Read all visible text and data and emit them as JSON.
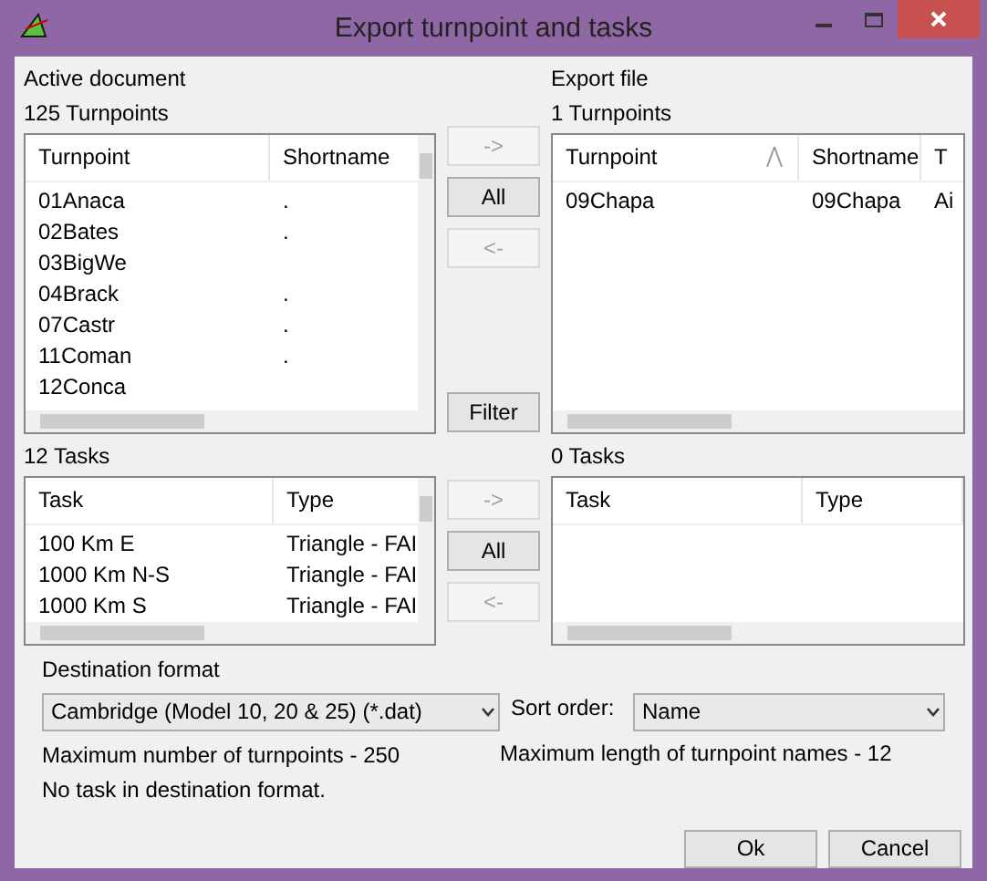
{
  "window": {
    "title": "Export turnpoint and tasks"
  },
  "source": {
    "heading": "Active document",
    "count": "125 Turnpoints",
    "list": {
      "columns": [
        {
          "label": "Turnpoint",
          "sorted": false
        },
        {
          "label": "Shortname",
          "sorted": false
        }
      ],
      "rows": [
        [
          "01Anaca",
          "."
        ],
        [
          "02Bates",
          "."
        ],
        [
          "03BigWe",
          ""
        ],
        [
          "04Brack",
          "."
        ],
        [
          "07Castr",
          "."
        ],
        [
          "11Coman",
          "."
        ],
        [
          "12Conca",
          ""
        ]
      ]
    }
  },
  "target": {
    "heading": "Export file",
    "count": "1 Turnpoints",
    "list": {
      "columns": [
        {
          "label": "Turnpoint",
          "sorted": true
        },
        {
          "label": "Shortname",
          "sorted": false
        },
        {
          "label": "T",
          "sorted": false
        }
      ],
      "rows": [
        [
          "09Chapa",
          "09Chapa",
          "Ai"
        ]
      ]
    }
  },
  "turnpoint_buttons": [
    {
      "label": "->",
      "disabled": true
    },
    {
      "label": "All",
      "disabled": false
    },
    {
      "label": "<-",
      "disabled": true
    },
    {
      "label": "Filter",
      "disabled": false
    }
  ],
  "source_tasks": {
    "count": "12 Tasks",
    "list": {
      "columns": [
        {
          "label": "Task",
          "sorted": false
        },
        {
          "label": "Type",
          "sorted": false
        }
      ],
      "rows": [
        [
          "100 Km E",
          "Triangle - FAI"
        ],
        [
          "1000 Km N-S",
          "Triangle - FAI"
        ],
        [
          "1000 Km S",
          "Triangle - FAI"
        ]
      ]
    }
  },
  "target_tasks": {
    "count": "0 Tasks",
    "list": {
      "columns": [
        {
          "label": "Task",
          "sorted": false
        },
        {
          "label": "Type",
          "sorted": false
        }
      ]
    }
  },
  "task_buttons": [
    {
      "label": "->",
      "disabled": true
    },
    {
      "label": "All",
      "disabled": false
    },
    {
      "label": "<-",
      "disabled": true
    }
  ],
  "destination_format": {
    "label": "Destination format",
    "value": "Cambridge (Model 10, 20 & 25) (*.dat)"
  },
  "sort_order": {
    "label": "Sort order:",
    "value": "Name"
  },
  "info": {
    "max_turnpoints": "Maximum number of turnpoints - 250",
    "max_name_length": "Maximum length of turnpoint names - 12",
    "task_note": "No task in destination format."
  },
  "buttons": [
    {
      "label": "Ok"
    },
    {
      "label": "Cancel"
    }
  ]
}
